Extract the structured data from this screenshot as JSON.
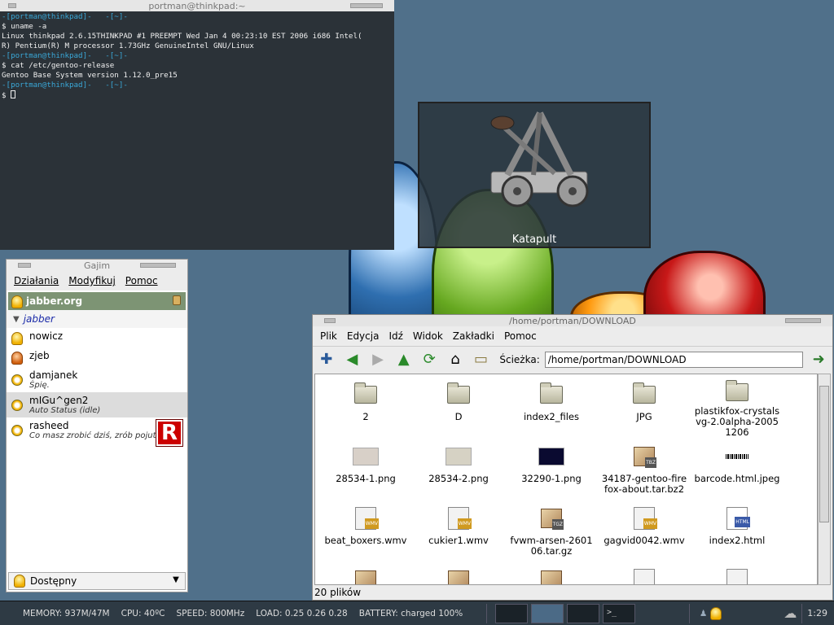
{
  "terminal": {
    "title": "portman@thinkpad:~",
    "lines": [
      {
        "kind": "prompt",
        "text": "-[portman@thinkpad]-   -[~]-"
      },
      {
        "kind": "cmd",
        "text": "$ uname -a"
      },
      {
        "kind": "out",
        "text": "Linux thinkpad 2.6.15THINKPAD #1 PREEMPT Wed Jan 4 00:23:10 EST 2006 i686 Intel("
      },
      {
        "kind": "out",
        "text": "R) Pentium(R) M processor 1.73GHz GenuineIntel GNU/Linux"
      },
      {
        "kind": "prompt",
        "text": "-[portman@thinkpad]-   -[~]-"
      },
      {
        "kind": "cmd",
        "text": "$ cat /etc/gentoo-release"
      },
      {
        "kind": "out",
        "text": "Gentoo Base System version 1.12.0_pre15"
      },
      {
        "kind": "prompt",
        "text": "-[portman@thinkpad]-   -[~]-"
      },
      {
        "kind": "cmd",
        "text": "$ "
      }
    ]
  },
  "katapult": {
    "label": "Katapult",
    "icon": "catapult-icon"
  },
  "gajim": {
    "title": "Gajim",
    "menu": [
      "Działania",
      "Modyfikuj",
      "Pomoc"
    ],
    "account": "jabber.org",
    "group": "jabber",
    "contacts": [
      {
        "name": "nowicz",
        "status": "",
        "icon": "online-bulb-icon",
        "selected": false
      },
      {
        "name": "zjeb",
        "status": "",
        "icon": "dnd-bulb-icon",
        "selected": false
      },
      {
        "name": "damjanek",
        "status": "Śpię.",
        "icon": "away-icon",
        "selected": false
      },
      {
        "name": "mIGu^gen2",
        "status": "Auto Status (idle)",
        "icon": "away-icon",
        "selected": true
      },
      {
        "name": "rasheed",
        "status": "Co masz zrobić dziś, zrób pojutrz",
        "icon": "away-icon",
        "selected": false,
        "avatar": "R"
      }
    ],
    "presence": "Dostępny"
  },
  "filemanager": {
    "title": "/home/portman/DOWNLOAD",
    "menu": [
      "Plik",
      "Edycja",
      "Idź",
      "Widok",
      "Zakładki",
      "Pomoc"
    ],
    "path_label": "Ścieżka:",
    "path": "/home/portman/DOWNLOAD",
    "status": "20 plików",
    "files": [
      {
        "name": "2",
        "type": "folder"
      },
      {
        "name": "D",
        "type": "folder"
      },
      {
        "name": "index2_files",
        "type": "folder"
      },
      {
        "name": "JPG",
        "type": "folder"
      },
      {
        "name": "plastikfox-crystalsvg-2.0alpha-20051206",
        "type": "folder"
      },
      {
        "name": "28534-1.png",
        "type": "thumb",
        "color": "#d8d0c8"
      },
      {
        "name": "28534-2.png",
        "type": "thumb",
        "color": "#d6d2c4"
      },
      {
        "name": "32290-1.png",
        "type": "thumb",
        "color": "#0a0a30"
      },
      {
        "name": "34187-gentoo-firefox-about.tar.bz2",
        "type": "pkg",
        "badge": "TBZ"
      },
      {
        "name": "barcode.html.jpeg",
        "type": "barcode"
      },
      {
        "name": "beat_boxers.wmv",
        "type": "vid",
        "badge": "WMV"
      },
      {
        "name": "cukier1.wmv",
        "type": "vid",
        "badge": "WMV"
      },
      {
        "name": "fvwm-arsen-260106.tar.gz",
        "type": "pkg",
        "badge": "TGZ"
      },
      {
        "name": "gagvid0042.wmv",
        "type": "vid",
        "badge": "WMV"
      },
      {
        "name": "index2.html",
        "type": "doc",
        "badge": "HTML"
      },
      {
        "name": "",
        "type": "pkg",
        "badge": ""
      },
      {
        "name": "",
        "type": "pkg",
        "badge": ""
      },
      {
        "name": "",
        "type": "pkg",
        "badge": ""
      },
      {
        "name": "",
        "type": "vid",
        "badge": ""
      },
      {
        "name": "",
        "type": "vid",
        "badge": ""
      }
    ]
  },
  "panel": {
    "memory": "MEMORY: 937M/47M",
    "cpu": "CPU: 40ºC",
    "speed": "SPEED: 800MHz",
    "load": "LOAD: 0.25 0.26 0.28",
    "battery": "BATTERY: charged 100%",
    "clock": "1:29"
  }
}
